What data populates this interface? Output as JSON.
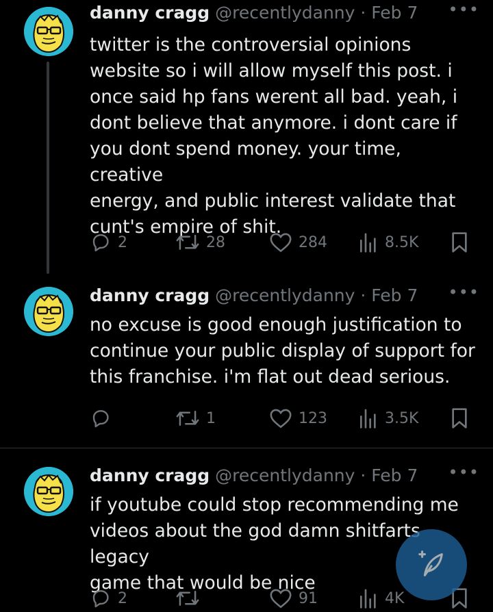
{
  "tweets": [
    {
      "author_name": "danny cragg",
      "handle": "@recentlydanny",
      "separator": "·",
      "date": "Feb 7",
      "more": "•••",
      "lines": [
        "twitter is the controversial opinions",
        "website so i will allow myself this post. i",
        "once said hp fans werent all bad. yeah, i",
        "dont believe that anymore. i dont care if",
        "you dont spend money. your time, creative",
        "energy, and public interest validate that",
        "cunt's empire of shit."
      ],
      "replies": "2",
      "reposts": "28",
      "likes": "284",
      "views": "8.5K"
    },
    {
      "author_name": "danny cragg",
      "handle": "@recentlydanny",
      "separator": "·",
      "date": "Feb 7",
      "more": "•••",
      "lines": [
        "no excuse is good enough justification to",
        "continue your public display of support for",
        "this franchise. i'm flat out dead serious."
      ],
      "replies": "",
      "reposts": "1",
      "likes": "123",
      "views": "3.5K"
    },
    {
      "author_name": "danny cragg",
      "handle": "@recentlydanny",
      "separator": "·",
      "date": "Feb 7",
      "more": "•••",
      "lines": [
        "if youtube could stop recommending me",
        "videos about the god damn shitfarts legacy",
        "game that would be nice"
      ],
      "replies": "2",
      "reposts": "",
      "likes": "91",
      "views": "4K"
    }
  ],
  "compose_button": {
    "icon": "compose-feather-icon",
    "color": "#1d9bf0"
  },
  "colors": {
    "background": "#000000",
    "text": "#e7e9ea",
    "muted": "#71767b",
    "avatar_bg": "#2bb8d3",
    "avatar_face": "#f6e04a"
  }
}
